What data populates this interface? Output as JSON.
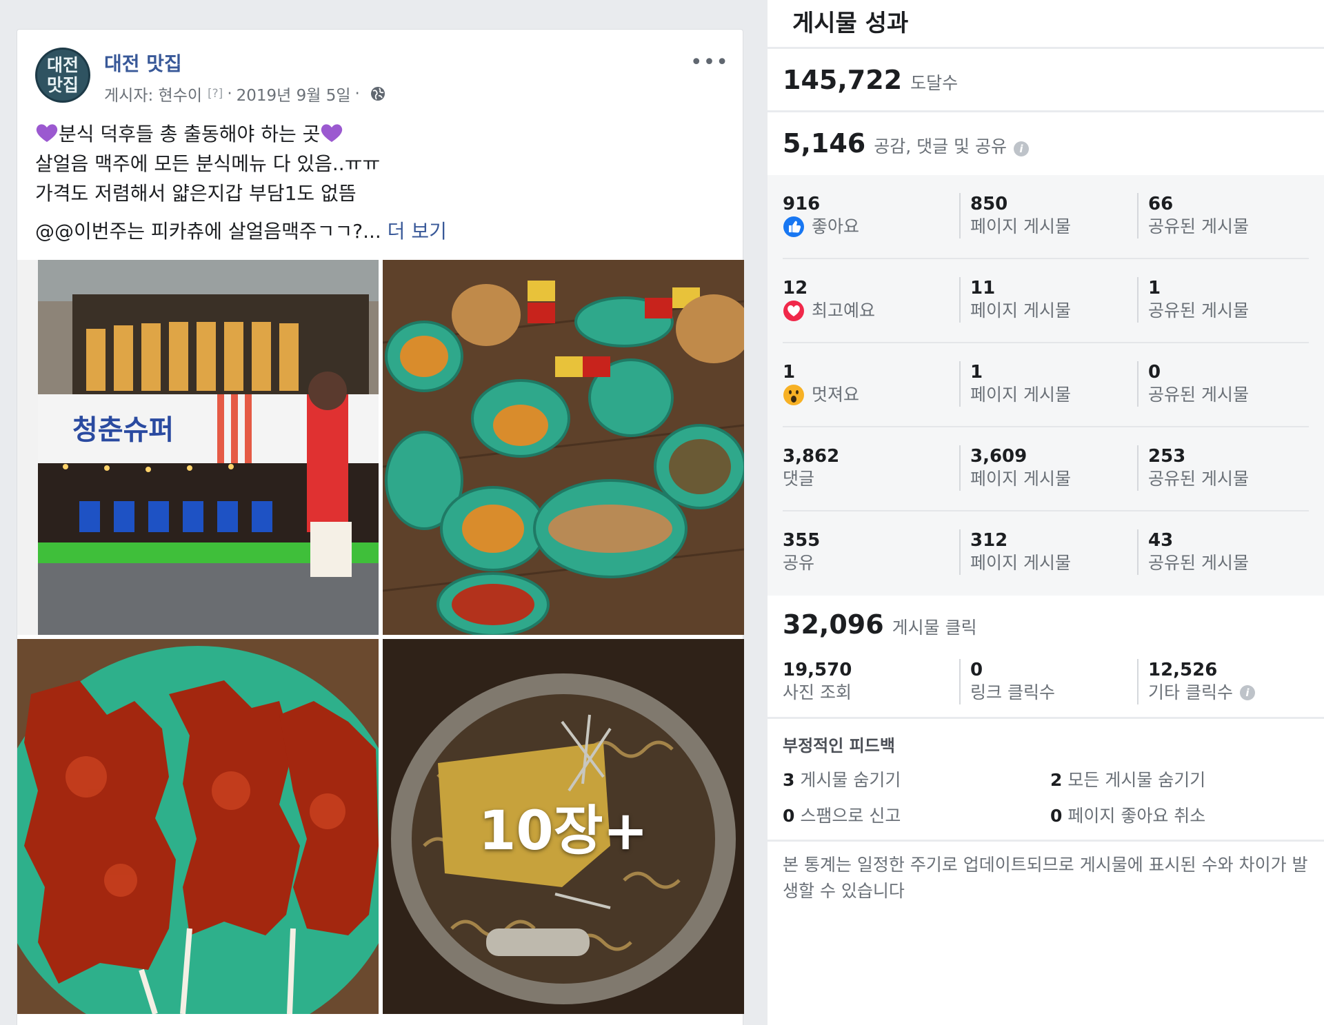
{
  "post": {
    "page_name": "대전 맛집",
    "avatar_line1": "대전",
    "avatar_line2": "맛집",
    "author_prefix": "게시자:",
    "author": "현수이",
    "author_q": "[?]",
    "date": "2019년 9월 5일",
    "more_menu": "•••",
    "text": {
      "line1": "분식 덕후들 총 출동해야 하는 곳",
      "line2": "살얼음 맥주에 모든 분식메뉴 다 있음..ㅠㅠ",
      "line3": "가격도 저렴해서 얇은지갑 부담1도 없뜸",
      "line4": "@@이번주는 피카츄에 살얼음맥주ㄱㄱ?...",
      "see_more": "더 보기"
    },
    "photos": {
      "sign_text": "청춘슈퍼",
      "more_overlay": "10장+"
    }
  },
  "insights": {
    "title": "게시물 성과",
    "reach": {
      "value": "145,722",
      "label": "도달수"
    },
    "engagement": {
      "value": "5,146",
      "label": "공감, 댓글 및 공유"
    },
    "rows": [
      {
        "value": "916",
        "label": "좋아요",
        "page_value": "850",
        "page_label": "페이지 게시물",
        "shared_value": "66",
        "shared_label": "공유된 게시물"
      },
      {
        "value": "12",
        "label": "최고예요",
        "page_value": "11",
        "page_label": "페이지 게시물",
        "shared_value": "1",
        "shared_label": "공유된 게시물"
      },
      {
        "value": "1",
        "label": "멋져요",
        "page_value": "1",
        "page_label": "페이지 게시물",
        "shared_value": "0",
        "shared_label": "공유된 게시물"
      },
      {
        "value": "3,862",
        "label": "댓글",
        "page_value": "3,609",
        "page_label": "페이지 게시물",
        "shared_value": "253",
        "shared_label": "공유된 게시물"
      },
      {
        "value": "355",
        "label": "공유",
        "page_value": "312",
        "page_label": "페이지 게시물",
        "shared_value": "43",
        "shared_label": "공유된 게시물"
      }
    ],
    "clicks": {
      "value": "32,096",
      "label": "게시물 클릭",
      "photo_value": "19,570",
      "photo_label": "사진 조회",
      "link_value": "0",
      "link_label": "링크 클릭수",
      "other_value": "12,526",
      "other_label": "기타 클릭수"
    },
    "negative": {
      "title": "부정적인 피드백",
      "hide_post_value": "3",
      "hide_post_label": "게시물 숨기기",
      "hide_all_value": "2",
      "hide_all_label": "모든 게시물 숨기기",
      "spam_value": "0",
      "spam_label": "스팸으로 신고",
      "unlike_value": "0",
      "unlike_label": "페이지 좋아요 취소"
    },
    "footnote": "본 통계는 일정한 주기로 업데이트되므로 게시물에 표시된 수와 차이가 발생할 수 있습니다"
  },
  "colors": {
    "link_blue": "#385898",
    "like_blue": "#1877f2",
    "love_red": "#f0284a",
    "wow_yellow": "#f7b125",
    "heart_purple": "#9b59d0"
  }
}
